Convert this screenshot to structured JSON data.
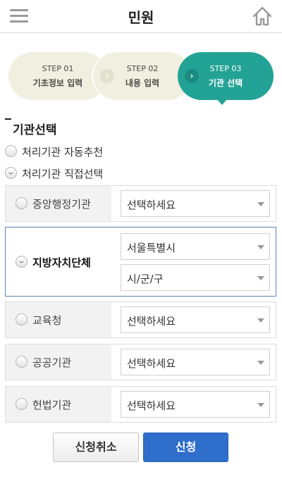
{
  "header": {
    "title": "민원",
    "menu_icon": "hamburger-menu-icon",
    "home_icon": "home-icon"
  },
  "steps": [
    {
      "num": "STEP 01",
      "label": "기초정보 입력"
    },
    {
      "num": "STEP 02",
      "label": "내용 입력"
    },
    {
      "num": "STEP 03",
      "label": "기관 선택"
    }
  ],
  "section": {
    "title": "기관선택"
  },
  "options": {
    "auto": "처리기관 자동추천",
    "direct": "처리기관 직접선택"
  },
  "agencies": {
    "central": {
      "name": "중앙행정기관",
      "select": "선택하세요"
    },
    "local": {
      "name": "지방자치단체",
      "select1": "서울특별시",
      "select2": "시/군/구"
    },
    "education": {
      "name": "교육청",
      "select": "선택하세요"
    },
    "public": {
      "name": "공공기관",
      "select": "선택하세요"
    },
    "constitutional": {
      "name": "헌법기관",
      "select": "선택하세요"
    }
  },
  "buttons": {
    "cancel": "신청취소",
    "submit": "신청"
  },
  "colors": {
    "accent_teal": "#23a395",
    "submit_blue": "#2f6ecb",
    "active_border": "#5d7fb9"
  }
}
